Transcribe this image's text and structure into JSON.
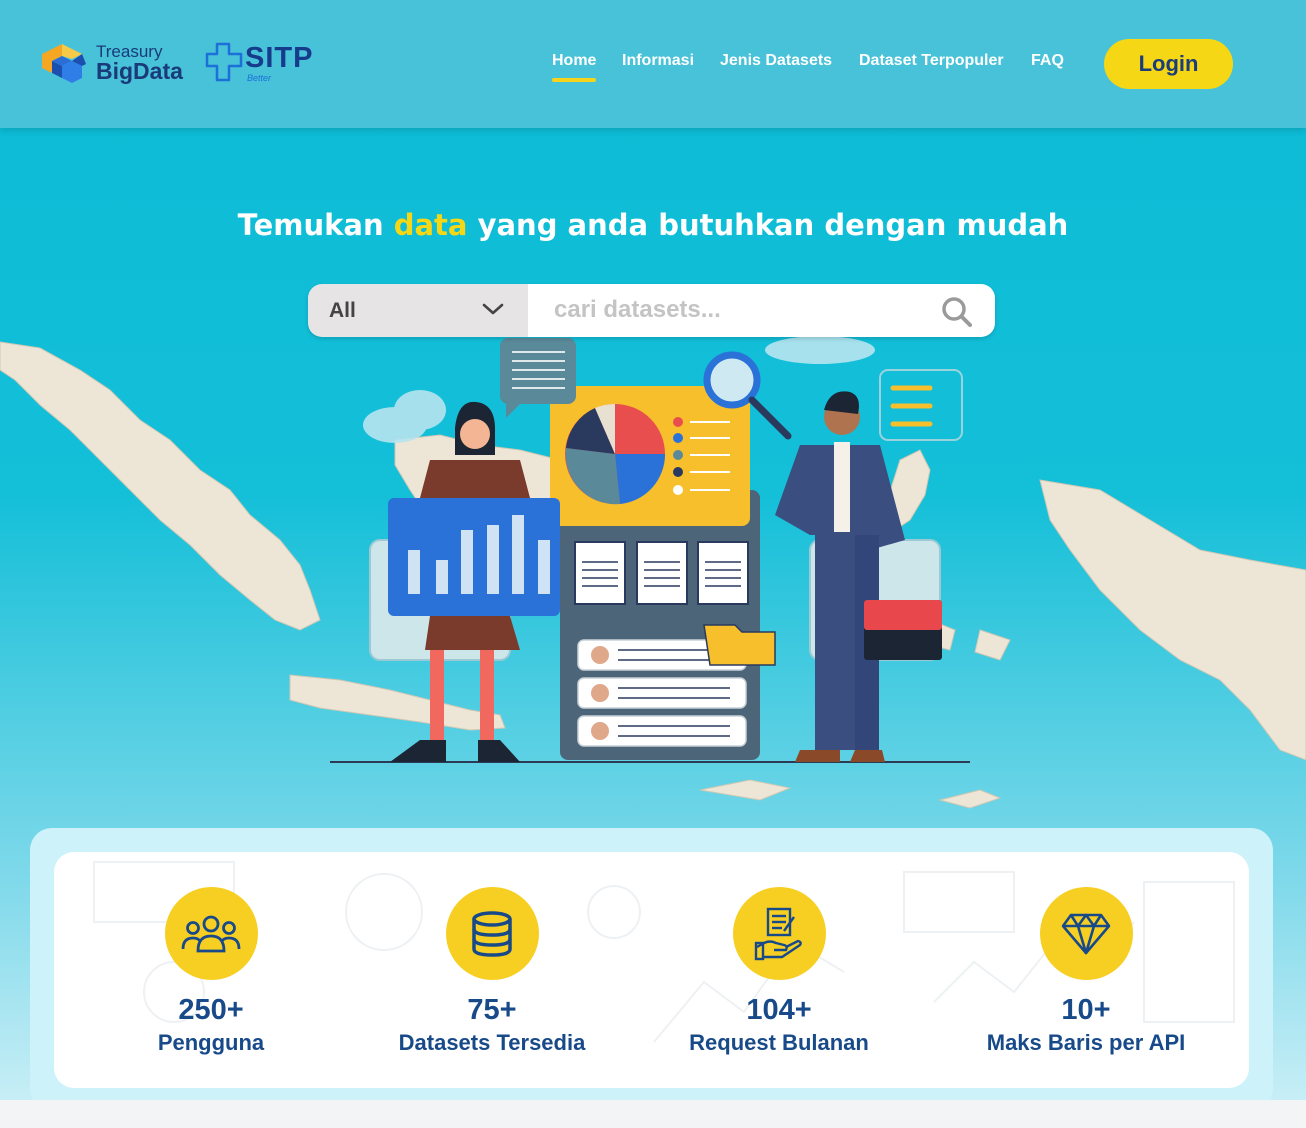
{
  "header": {
    "logo_treasury_line1": "Treasury",
    "logo_treasury_line2": "BigData",
    "logo_sitp": "SITP",
    "logo_sitp_sub": "Better",
    "nav": [
      {
        "label": "Home",
        "active": true
      },
      {
        "label": "Informasi",
        "active": false
      },
      {
        "label": "Jenis Datasets",
        "active": false
      },
      {
        "label": "Dataset Terpopuler",
        "active": false
      },
      {
        "label": "FAQ",
        "active": false
      }
    ],
    "login_label": "Login"
  },
  "hero": {
    "title_pre": "Temukan ",
    "title_highlight": "data",
    "title_post": " yang anda butuhkan dengan mudah"
  },
  "search": {
    "category_selected": "All",
    "placeholder": "cari datasets..."
  },
  "stats": [
    {
      "value": "250+",
      "label": "Pengguna",
      "icon": "users-icon"
    },
    {
      "value": "75+",
      "label": "Datasets Tersedia",
      "icon": "database-icon"
    },
    {
      "value": "104+",
      "label": "Request Bulanan",
      "icon": "request-document-hand-icon"
    },
    {
      "value": "10+",
      "label": "Maks Baris per API",
      "icon": "diamond-icon"
    }
  ],
  "colors": {
    "header_bg": "#47c2d8",
    "hero_bg": "#0bbbd6",
    "accent_yellow": "#f5d716",
    "text_navy": "#184a8a"
  }
}
